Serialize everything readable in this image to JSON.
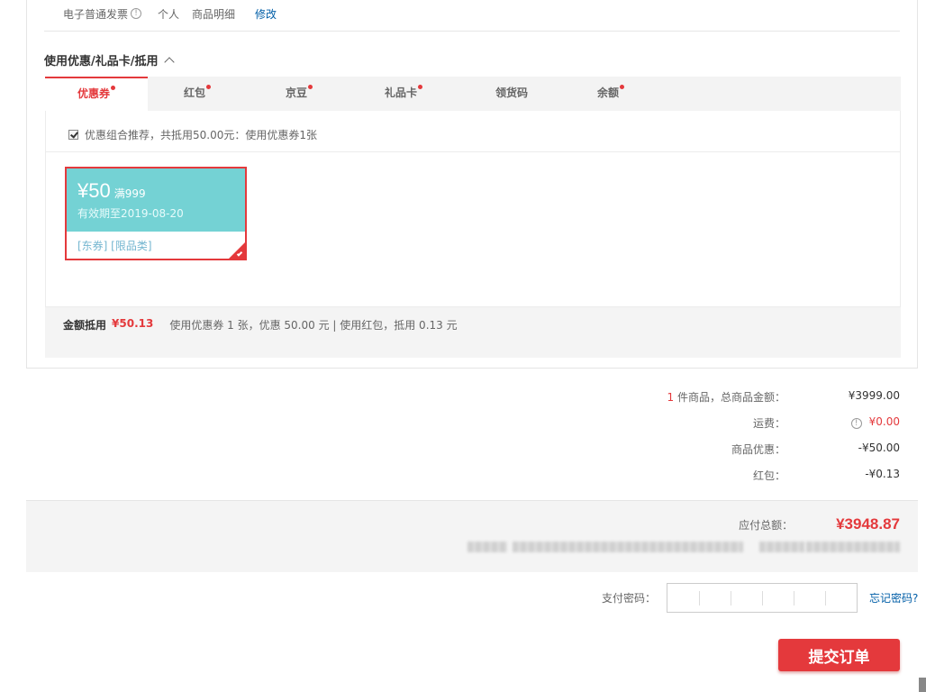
{
  "invoice": {
    "type": "电子普通发票",
    "title": "个人",
    "content": "商品明细",
    "edit_label": "修改"
  },
  "discount_section": {
    "title": "使用优惠/礼品卡/抵用",
    "tabs": [
      {
        "label": "优惠券",
        "active": true,
        "dot": true
      },
      {
        "label": "红包",
        "active": false,
        "dot": true
      },
      {
        "label": "京豆",
        "active": false,
        "dot": true
      },
      {
        "label": "礼品卡",
        "active": false,
        "dot": true
      },
      {
        "label": "领货码",
        "active": false,
        "dot": false
      },
      {
        "label": "余额",
        "active": false,
        "dot": true
      }
    ],
    "combo_recommend": "优惠组合推荐，共抵用50.00元：使用优惠券1张",
    "coupon": {
      "amount": "¥50",
      "condition": "满999",
      "validity": "有效期至2019-08-20",
      "tags": "[东券]  [限品类]"
    },
    "summary": {
      "label": "金额抵用",
      "amount": "¥50.13",
      "detail": "使用优惠券 1 张，优惠 50.00 元  | 使用红包，抵用 0.13 元"
    }
  },
  "totals": {
    "items_count": "1",
    "items_label": " 件商品，总商品金额：",
    "items_total": "¥3999.00",
    "shipping_label": "运费：",
    "shipping_value": "¥0.00",
    "discount_label": "商品优惠：",
    "discount_value": "-¥50.00",
    "redpacket_label": "红包：",
    "redpacket_value": "-¥0.13"
  },
  "payment": {
    "due_label": "应付总额：",
    "due_value": "¥3948.87",
    "password_label": "支付密码：",
    "forgot_label": "忘记密码?",
    "submit_label": "提交订单"
  },
  "colors": {
    "accent_red": "#e4393c",
    "coupon_teal": "#74d2d4",
    "link_blue": "#005ea7"
  }
}
